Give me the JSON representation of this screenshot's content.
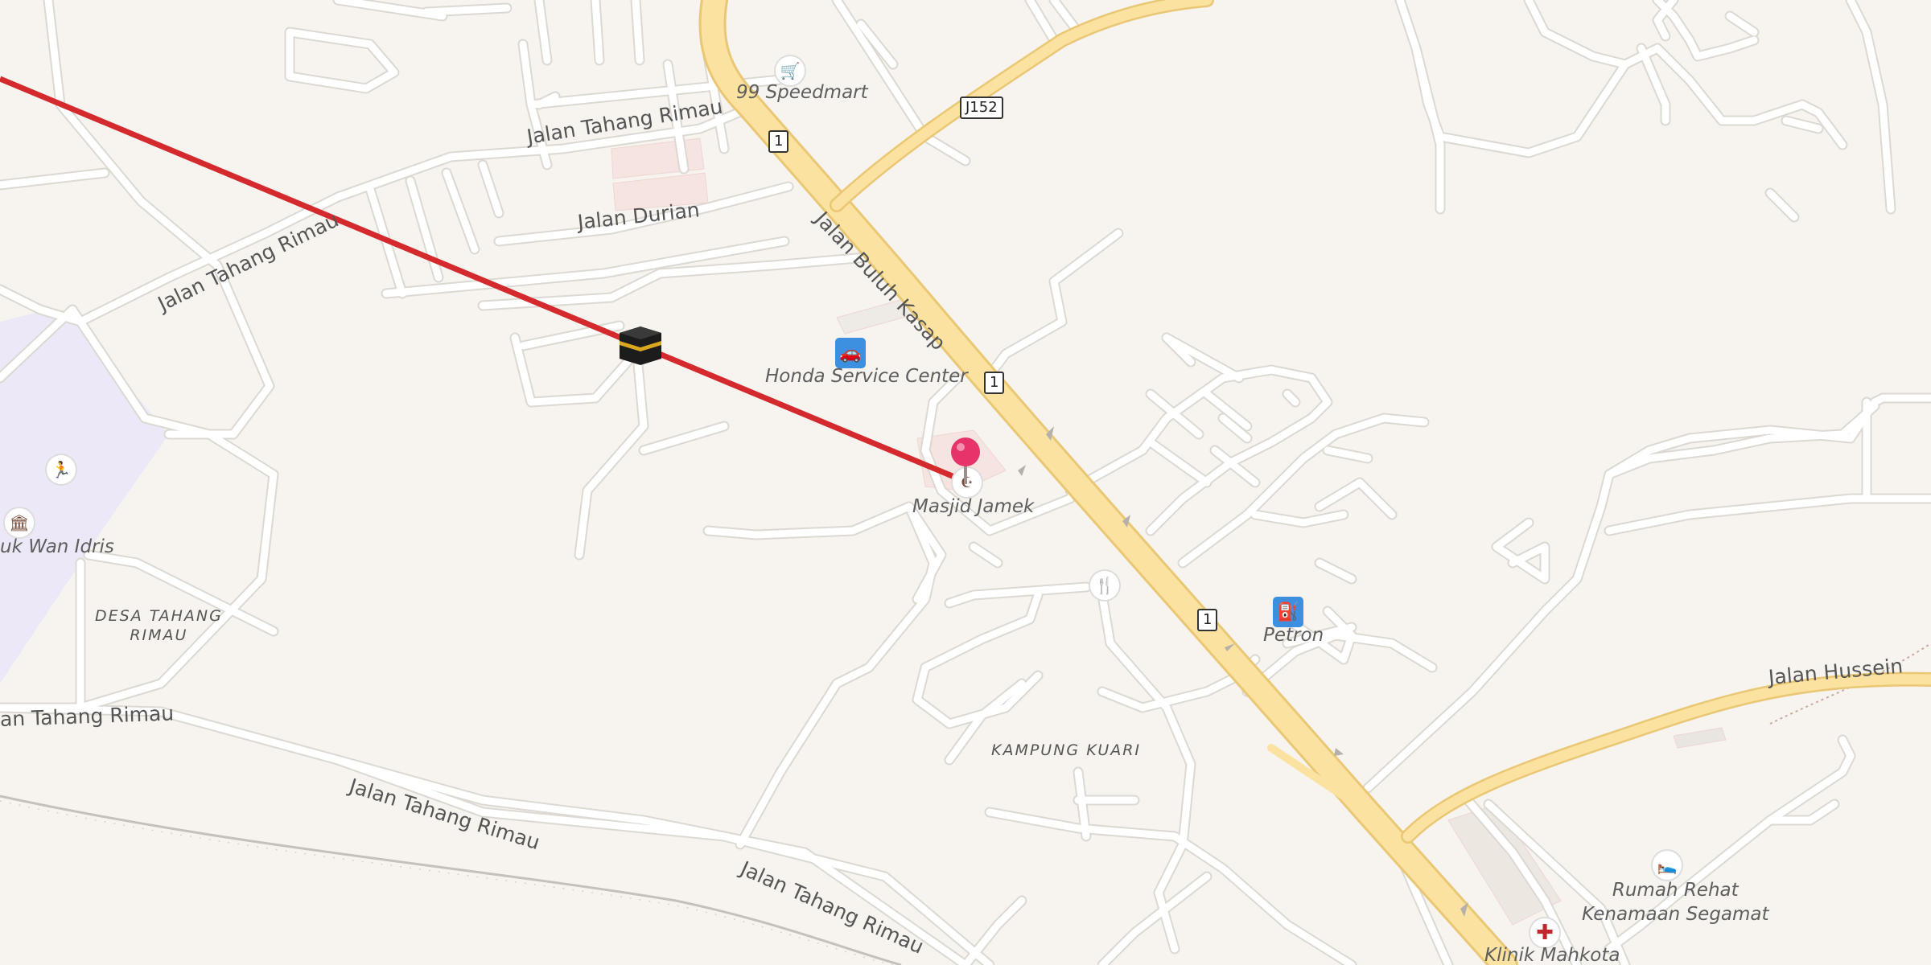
{
  "map": {
    "colors": {
      "background": "#f7f4f0",
      "minor_road": "#ffffff",
      "minor_road_casing": "#dcd8d2",
      "major_road": "#fbe2a0",
      "major_road_casing": "#e9c774",
      "route_line": "#d42a2e",
      "park_area": "#ece8f7",
      "building": "#f6e4e1",
      "railway": "#bdb8b2"
    },
    "road_labels": [
      {
        "text": "Jalan Tahang Rimau"
      },
      {
        "text": "Jalan Durian"
      },
      {
        "text": "Jalan Tahang Rimau"
      },
      {
        "text": "Jalan Buluh Kasap"
      },
      {
        "text": "an Tahang Rimau"
      },
      {
        "text": "Jalan Tahang Rimau"
      },
      {
        "text": "Jalan Tahang Rimau"
      },
      {
        "text": "Jalan Hussein"
      }
    ],
    "route_shields": [
      "1",
      "J152",
      "1",
      "1"
    ],
    "pois": [
      {
        "name": "99 Speedmart",
        "icon": "shopping-cart-icon"
      },
      {
        "name": "Honda Service Center",
        "icon": "car-icon"
      },
      {
        "name": "Masjid Jamek",
        "icon": "mosque-icon"
      },
      {
        "name": "Petron",
        "icon": "fuel-icon"
      },
      {
        "name": "uk Wan Idris",
        "icon": "building-icon"
      },
      {
        "name": "Rumah Rehat\nKenamaan Segamat",
        "icon": "bed-icon"
      },
      {
        "name": "Klinik Mahkota",
        "icon": "medical-cross-icon"
      },
      {
        "name": "",
        "icon": "restaurant-icon"
      },
      {
        "name": "",
        "icon": "running-icon"
      }
    ],
    "area_labels": [
      {
        "text": "DESA TAHANG\nRIMAU"
      },
      {
        "text": "KAMPUNG KUARI"
      }
    ],
    "markers": {
      "pin": {
        "icon": "location-pin-icon",
        "color": "#e6336a"
      },
      "kaaba": {
        "icon": "kaaba-icon"
      }
    }
  }
}
